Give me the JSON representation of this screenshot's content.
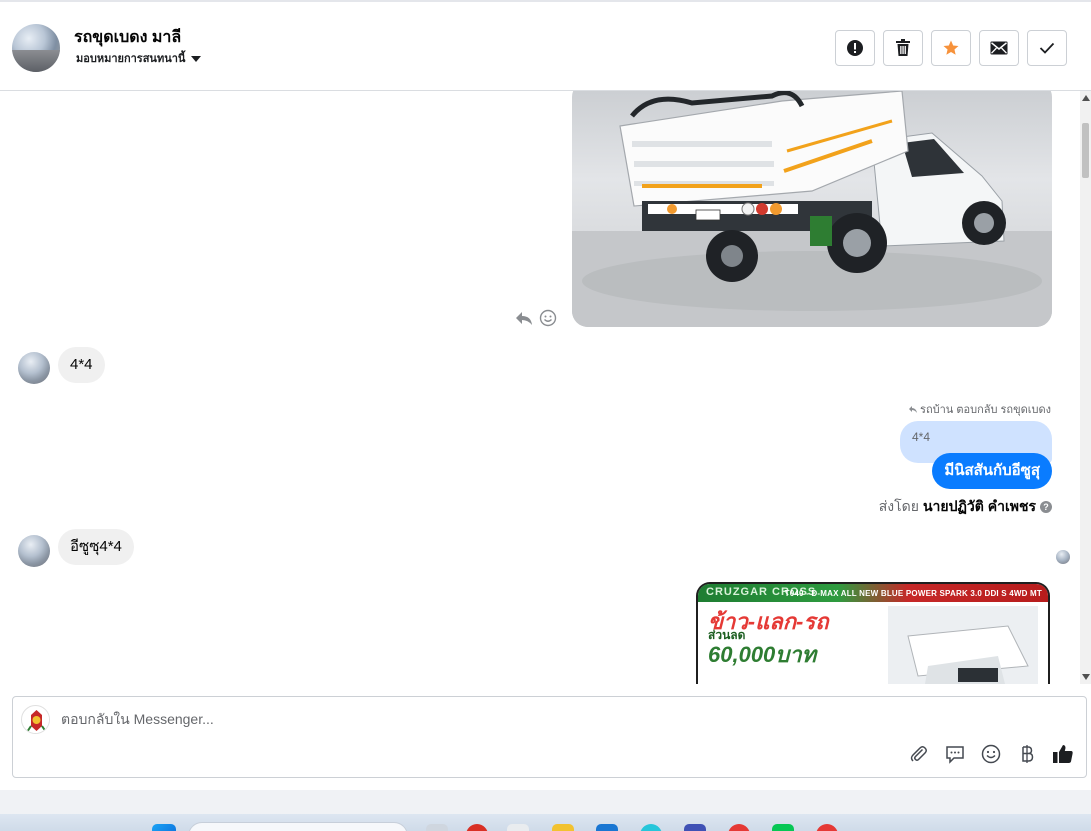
{
  "header": {
    "contact_name": "รถขุดเบดง มาลี",
    "assign_label": "มอบหมายการสนทนานี้",
    "actions": [
      {
        "name": "report",
        "icon": "exclamation-circle-icon"
      },
      {
        "name": "delete",
        "icon": "trash-icon"
      },
      {
        "name": "star",
        "icon": "star-icon"
      },
      {
        "name": "mark-unread",
        "icon": "envelope-icon"
      },
      {
        "name": "done",
        "icon": "check-icon"
      }
    ]
  },
  "thread": {
    "incoming_1": "4*4",
    "reply_note": "รถบ้าน ตอบกลับ รถขุดเบดง",
    "quoted_text": "4*4",
    "outgoing_1": "มีนิสสันกับอีซูสุ",
    "sent_by_prefix": "ส่งโดย",
    "sent_by_name": "นายปฏิวัติ คำเพชร",
    "incoming_2": "อีซูซุ4*4",
    "promo": {
      "brand": "CRUZGAR CROSS",
      "model": "T040 - D-MAX ALL NEW BLUE POWER SPARK 3.0 DDI S 4WD MT",
      "title": "ข้าว-แลก-รถ",
      "sub": "ส่วนลด",
      "amount": "60,000บาท"
    }
  },
  "composer": {
    "placeholder": "ตอบกลับใน Messenger...",
    "tools": [
      "paperclip-icon",
      "chat-bubble-icon",
      "emoji-icon",
      "baht-icon",
      "thumbs-up-icon"
    ]
  },
  "colors": {
    "accent": "#0a7cff",
    "quote_bg": "#cfe2ff",
    "incoming_bg": "#f0f0f0",
    "star": "#f7923b"
  }
}
